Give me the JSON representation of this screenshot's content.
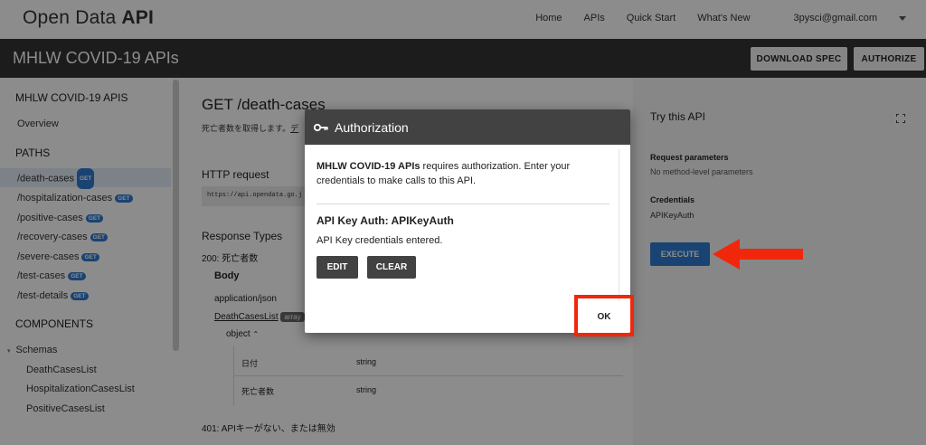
{
  "topnav": {
    "brand_light": "Open Data",
    "brand_bold": "API",
    "links": [
      "Home",
      "APIs",
      "Quick Start",
      "What's New"
    ],
    "account": "3pysci@gmail.com"
  },
  "titlebar": {
    "title": "MHLW COVID-19 APIs",
    "download_label": "DOWNLOAD SPEC",
    "authorize_label": "AUTHORIZE"
  },
  "sidebar": {
    "heading": "MHLW COVID-19 APIS",
    "overview": "Overview",
    "paths_heading": "PATHS",
    "paths": [
      "/death-cases",
      "/hospitalization-cases",
      "/positive-cases",
      "/recovery-cases",
      "/severe-cases",
      "/test-cases",
      "/test-details"
    ],
    "method_badge": "GET",
    "components_heading": "COMPONENTS",
    "schemas_label": "Schemas",
    "schemas": [
      "DeathCasesList",
      "HospitalizationCasesList",
      "PositiveCasesList"
    ]
  },
  "main": {
    "title": "GET /death-cases",
    "description": "死亡者数を取得します。",
    "description_link": "デ",
    "http_request_label": "HTTP request",
    "request_url": "https://api.opendata.go.j",
    "response_types_label": "Response Types",
    "response_200": "200: 死亡者数",
    "body_label": "Body",
    "content_type": "application/json",
    "schema_link": "DeathCasesList",
    "schema_badge": "array",
    "object_label": "object",
    "fields": [
      {
        "name": "日付",
        "type": "string"
      },
      {
        "name": "死亡者数",
        "type": "string"
      }
    ],
    "response_401": "401: APIキーがない、または無効"
  },
  "right": {
    "try_label": "Try this API",
    "req_params_label": "Request parameters",
    "req_params_value": "No method-level parameters",
    "credentials_label": "Credentials",
    "credentials_value": "APIKeyAuth",
    "execute_label": "EXECUTE"
  },
  "dialog": {
    "title": "Authorization",
    "intro_bold": "MHLW COVID-19 APIs",
    "intro_rest": " requires authorization. Enter your credentials to make calls to this API.",
    "auth_title": "API Key Auth: APIKeyAuth",
    "status": "API Key credentials entered.",
    "edit_label": "EDIT",
    "clear_label": "CLEAR",
    "ok_label": "OK"
  },
  "colors": {
    "highlight": "#f0270b",
    "execute": "#2f7bd0",
    "titlebar": "#333333"
  },
  "icons": [
    "key-icon",
    "fullscreen-icon",
    "chevron-up-icon",
    "dropdown-caret-icon",
    "arrow-icon"
  ]
}
